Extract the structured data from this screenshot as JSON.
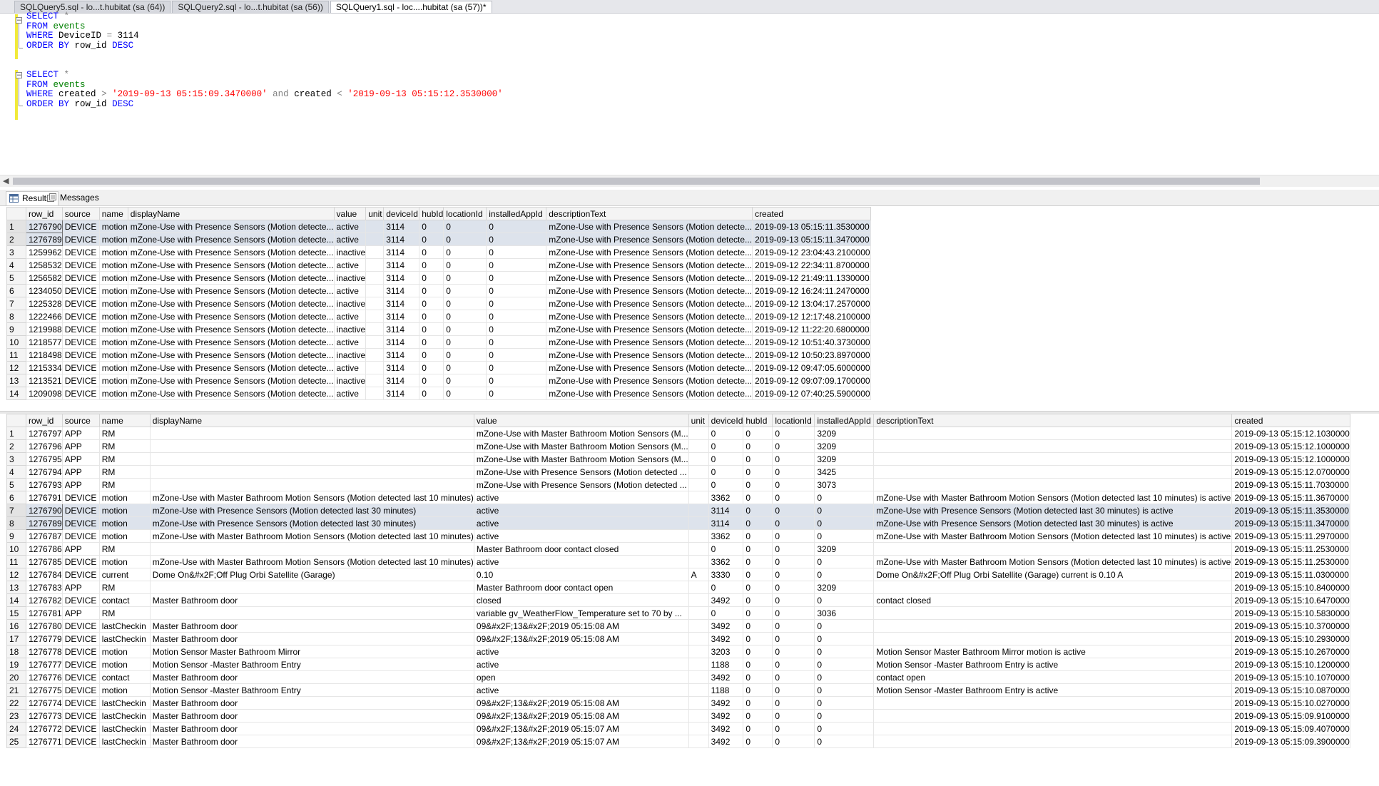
{
  "tabs": [
    {
      "label": "SQLQuery5.sql - lo...t.hubitat (sa (64))",
      "active": false
    },
    {
      "label": "SQLQuery2.sql - lo...t.hubitat (sa (56))",
      "active": false
    },
    {
      "label": "SQLQuery1.sql - loc....hubitat (sa (57))*",
      "active": true
    }
  ],
  "editor": {
    "q1": {
      "select": "SELECT",
      "star": "*",
      "from": "FROM",
      "table": "events",
      "where": "WHERE",
      "w_rest": "DeviceID",
      "eq": "=",
      "val": "3114",
      "order": "ORDER BY",
      "col": "row_id",
      "desc": "DESC"
    },
    "q2": {
      "select": "SELECT",
      "star": "*",
      "from": "FROM",
      "table": "events",
      "where": "WHERE",
      "c1": "created",
      "gt": ">",
      "s1": "'2019-09-13 05:15:09.3470000'",
      "and": "and",
      "c2": "created",
      "lt": "<",
      "s2": "'2019-09-13 05:15:12.3530000'",
      "order": "ORDER BY",
      "col": "row_id",
      "desc": "DESC"
    }
  },
  "result_tabs": {
    "results": "Results",
    "messages": "Messages"
  },
  "colors": {
    "keyword": "#0000ff",
    "string": "#ff0000",
    "table": "#008000",
    "selection": "#dde3ec"
  },
  "grid1": {
    "columns": [
      "row_id",
      "source",
      "name",
      "displayName",
      "value",
      "unit",
      "deviceId",
      "hubId",
      "locationId",
      "installedAppId",
      "descriptionText",
      "created"
    ],
    "rows": [
      [
        "1276790",
        "DEVICE",
        "motion",
        "mZone-Use with Presence Sensors (Motion detecte...",
        "active",
        "",
        "3114",
        "0",
        "0",
        "0",
        "mZone-Use with Presence Sensors (Motion detecte...",
        "2019-09-13 05:15:11.3530000"
      ],
      [
        "1276789",
        "DEVICE",
        "motion",
        "mZone-Use with Presence Sensors (Motion detecte...",
        "active",
        "",
        "3114",
        "0",
        "0",
        "0",
        "mZone-Use with Presence Sensors (Motion detecte...",
        "2019-09-13 05:15:11.3470000"
      ],
      [
        "1259962",
        "DEVICE",
        "motion",
        "mZone-Use with Presence Sensors (Motion detecte...",
        "inactive",
        "",
        "3114",
        "0",
        "0",
        "0",
        "mZone-Use with Presence Sensors (Motion detecte...",
        "2019-09-12 23:04:43.2100000"
      ],
      [
        "1258532",
        "DEVICE",
        "motion",
        "mZone-Use with Presence Sensors (Motion detecte...",
        "active",
        "",
        "3114",
        "0",
        "0",
        "0",
        "mZone-Use with Presence Sensors (Motion detecte...",
        "2019-09-12 22:34:11.8700000"
      ],
      [
        "1256582",
        "DEVICE",
        "motion",
        "mZone-Use with Presence Sensors (Motion detecte...",
        "inactive",
        "",
        "3114",
        "0",
        "0",
        "0",
        "mZone-Use with Presence Sensors (Motion detecte...",
        "2019-09-12 21:49:11.1330000"
      ],
      [
        "1234050",
        "DEVICE",
        "motion",
        "mZone-Use with Presence Sensors (Motion detecte...",
        "active",
        "",
        "3114",
        "0",
        "0",
        "0",
        "mZone-Use with Presence Sensors (Motion detecte...",
        "2019-09-12 16:24:11.2470000"
      ],
      [
        "1225328",
        "DEVICE",
        "motion",
        "mZone-Use with Presence Sensors (Motion detecte...",
        "inactive",
        "",
        "3114",
        "0",
        "0",
        "0",
        "mZone-Use with Presence Sensors (Motion detecte...",
        "2019-09-12 13:04:17.2570000"
      ],
      [
        "1222466",
        "DEVICE",
        "motion",
        "mZone-Use with Presence Sensors (Motion detecte...",
        "active",
        "",
        "3114",
        "0",
        "0",
        "0",
        "mZone-Use with Presence Sensors (Motion detecte...",
        "2019-09-12 12:17:48.2100000"
      ],
      [
        "1219988",
        "DEVICE",
        "motion",
        "mZone-Use with Presence Sensors (Motion detecte...",
        "inactive",
        "",
        "3114",
        "0",
        "0",
        "0",
        "mZone-Use with Presence Sensors (Motion detecte...",
        "2019-09-12 11:22:20.6800000"
      ],
      [
        "1218577",
        "DEVICE",
        "motion",
        "mZone-Use with Presence Sensors (Motion detecte...",
        "active",
        "",
        "3114",
        "0",
        "0",
        "0",
        "mZone-Use with Presence Sensors (Motion detecte...",
        "2019-09-12 10:51:40.3730000"
      ],
      [
        "1218498",
        "DEVICE",
        "motion",
        "mZone-Use with Presence Sensors (Motion detecte...",
        "inactive",
        "",
        "3114",
        "0",
        "0",
        "0",
        "mZone-Use with Presence Sensors (Motion detecte...",
        "2019-09-12 10:50:23.8970000"
      ],
      [
        "1215334",
        "DEVICE",
        "motion",
        "mZone-Use with Presence Sensors (Motion detecte...",
        "active",
        "",
        "3114",
        "0",
        "0",
        "0",
        "mZone-Use with Presence Sensors (Motion detecte...",
        "2019-09-12 09:47:05.6000000"
      ],
      [
        "1213521",
        "DEVICE",
        "motion",
        "mZone-Use with Presence Sensors (Motion detecte...",
        "inactive",
        "",
        "3114",
        "0",
        "0",
        "0",
        "mZone-Use with Presence Sensors (Motion detecte...",
        "2019-09-12 09:07:09.1700000"
      ],
      [
        "1209098",
        "DEVICE",
        "motion",
        "mZone-Use with Presence Sensors (Motion detecte...",
        "active",
        "",
        "3114",
        "0",
        "0",
        "0",
        "mZone-Use with Presence Sensors (Motion detecte...",
        "2019-09-12 07:40:25.5900000"
      ]
    ],
    "selected": [
      0,
      1
    ]
  },
  "grid2": {
    "columns": [
      "row_id",
      "source",
      "name",
      "displayName",
      "value",
      "unit",
      "deviceId",
      "hubId",
      "locationId",
      "installedAppId",
      "descriptionText",
      "created"
    ],
    "rows": [
      [
        "1276797",
        "APP",
        "RM",
        "",
        "mZone-Use with Master Bathroom Motion Sensors (M...",
        "",
        "0",
        "0",
        "0",
        "3209",
        "",
        "2019-09-13 05:15:12.1030000"
      ],
      [
        "1276796",
        "APP",
        "RM",
        "",
        "mZone-Use with Master Bathroom Motion Sensors (M...",
        "",
        "0",
        "0",
        "0",
        "3209",
        "",
        "2019-09-13 05:15:12.1000000"
      ],
      [
        "1276795",
        "APP",
        "RM",
        "",
        "mZone-Use with Master Bathroom Motion Sensors (M...",
        "",
        "0",
        "0",
        "0",
        "3209",
        "",
        "2019-09-13 05:15:12.1000000"
      ],
      [
        "1276794",
        "APP",
        "RM",
        "",
        "mZone-Use with Presence Sensors (Motion detected ...",
        "",
        "0",
        "0",
        "0",
        "3425",
        "",
        "2019-09-13 05:15:12.0700000"
      ],
      [
        "1276793",
        "APP",
        "RM",
        "",
        "mZone-Use with Presence Sensors (Motion detected ...",
        "",
        "0",
        "0",
        "0",
        "3073",
        "",
        "2019-09-13 05:15:11.7030000"
      ],
      [
        "1276791",
        "DEVICE",
        "motion",
        "mZone-Use with Master Bathroom Motion Sensors (Motion detected last 10 minutes)",
        "active",
        "",
        "3362",
        "0",
        "0",
        "0",
        "mZone-Use with Master Bathroom Motion Sensors (Motion detected last 10 minutes) is active",
        "2019-09-13 05:15:11.3670000"
      ],
      [
        "1276790",
        "DEVICE",
        "motion",
        "mZone-Use with Presence Sensors (Motion detected last 30 minutes)",
        "active",
        "",
        "3114",
        "0",
        "0",
        "0",
        "mZone-Use with Presence Sensors (Motion detected last 30 minutes)  is active",
        "2019-09-13 05:15:11.3530000"
      ],
      [
        "1276789",
        "DEVICE",
        "motion",
        "mZone-Use with Presence Sensors (Motion detected last 30 minutes)",
        "active",
        "",
        "3114",
        "0",
        "0",
        "0",
        "mZone-Use with Presence Sensors (Motion detected last 30 minutes)  is active",
        "2019-09-13 05:15:11.3470000"
      ],
      [
        "1276787",
        "DEVICE",
        "motion",
        "mZone-Use with Master Bathroom Motion Sensors (Motion detected last 10 minutes)",
        "active",
        "",
        "3362",
        "0",
        "0",
        "0",
        "mZone-Use with Master Bathroom Motion Sensors (Motion detected last 10 minutes) is active",
        "2019-09-13 05:15:11.2970000"
      ],
      [
        "1276786",
        "APP",
        "RM",
        "",
        "Master Bathroom door contact closed",
        "",
        "0",
        "0",
        "0",
        "3209",
        "",
        "2019-09-13 05:15:11.2530000"
      ],
      [
        "1276785",
        "DEVICE",
        "motion",
        "mZone-Use with Master Bathroom Motion Sensors (Motion detected last 10 minutes)",
        "active",
        "",
        "3362",
        "0",
        "0",
        "0",
        "mZone-Use with Master Bathroom Motion Sensors (Motion detected last 10 minutes) is active",
        "2019-09-13 05:15:11.2530000"
      ],
      [
        "1276784",
        "DEVICE",
        "current",
        "Dome On&#x2F;Off Plug Orbi Satellite (Garage)",
        "0.10",
        "A",
        "3330",
        "0",
        "0",
        "0",
        "Dome On&#x2F;Off Plug Orbi Satellite (Garage) current is 0.10 A",
        "2019-09-13 05:15:11.0300000"
      ],
      [
        "1276783",
        "APP",
        "RM",
        "",
        "Master Bathroom door contact open",
        "",
        "0",
        "0",
        "0",
        "3209",
        "",
        "2019-09-13 05:15:10.8400000"
      ],
      [
        "1276782",
        "DEVICE",
        "contact",
        "Master Bathroom door",
        "closed",
        "",
        "3492",
        "0",
        "0",
        "0",
        "contact closed",
        "2019-09-13 05:15:10.6470000"
      ],
      [
        "1276781",
        "APP",
        "RM",
        "",
        "variable gv_WeatherFlow_Temperature set to 70 by ...",
        "",
        "0",
        "0",
        "0",
        "3036",
        "",
        "2019-09-13 05:15:10.5830000"
      ],
      [
        "1276780",
        "DEVICE",
        "lastCheckin",
        "Master Bathroom door",
        "09&#x2F;13&#x2F;2019 05:15:08 AM",
        "",
        "3492",
        "0",
        "0",
        "0",
        "",
        "2019-09-13 05:15:10.3700000"
      ],
      [
        "1276779",
        "DEVICE",
        "lastCheckin",
        "Master Bathroom door",
        "09&#x2F;13&#x2F;2019 05:15:08 AM",
        "",
        "3492",
        "0",
        "0",
        "0",
        "",
        "2019-09-13 05:15:10.2930000"
      ],
      [
        "1276778",
        "DEVICE",
        "motion",
        "Motion Sensor Master Bathroom Mirror",
        "active",
        "",
        "3203",
        "0",
        "0",
        "0",
        "Motion Sensor Master Bathroom Mirror  motion is active",
        "2019-09-13 05:15:10.2670000"
      ],
      [
        "1276777",
        "DEVICE",
        "motion",
        "Motion Sensor -Master Bathroom Entry",
        "active",
        "",
        "1188",
        "0",
        "0",
        "0",
        "Motion Sensor -Master Bathroom Entry is active",
        "2019-09-13 05:15:10.1200000"
      ],
      [
        "1276776",
        "DEVICE",
        "contact",
        "Master Bathroom door",
        "open",
        "",
        "3492",
        "0",
        "0",
        "0",
        "contact open",
        "2019-09-13 05:15:10.1070000"
      ],
      [
        "1276775",
        "DEVICE",
        "motion",
        "Motion Sensor -Master Bathroom Entry",
        "active",
        "",
        "1188",
        "0",
        "0",
        "0",
        "Motion Sensor -Master Bathroom Entry is active",
        "2019-09-13 05:15:10.0870000"
      ],
      [
        "1276774",
        "DEVICE",
        "lastCheckin",
        "Master Bathroom door",
        "09&#x2F;13&#x2F;2019 05:15:08 AM",
        "",
        "3492",
        "0",
        "0",
        "0",
        "",
        "2019-09-13 05:15:10.0270000"
      ],
      [
        "1276773",
        "DEVICE",
        "lastCheckin",
        "Master Bathroom door",
        "09&#x2F;13&#x2F;2019 05:15:08 AM",
        "",
        "3492",
        "0",
        "0",
        "0",
        "",
        "2019-09-13 05:15:09.9100000"
      ],
      [
        "1276772",
        "DEVICE",
        "lastCheckin",
        "Master Bathroom door",
        "09&#x2F;13&#x2F;2019 05:15:07 AM",
        "",
        "3492",
        "0",
        "0",
        "0",
        "",
        "2019-09-13 05:15:09.4070000"
      ],
      [
        "1276771",
        "DEVICE",
        "lastCheckin",
        "Master Bathroom door",
        "09&#x2F;13&#x2F;2019 05:15:07 AM",
        "",
        "3492",
        "0",
        "0",
        "0",
        "",
        "2019-09-13 05:15:09.3900000"
      ]
    ],
    "selected": [
      6,
      7
    ]
  }
}
